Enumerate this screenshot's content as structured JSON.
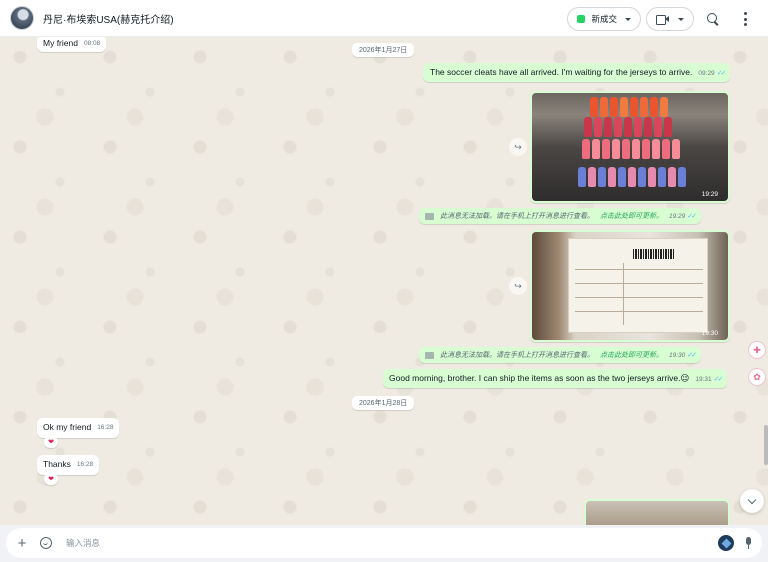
{
  "header": {
    "title": "丹尼·布埃索USA(赫克托介绍)",
    "status_pill_label": "新成交"
  },
  "messages": [
    {
      "direction": "in",
      "text": "My friend",
      "time": "08:08"
    },
    {
      "type": "date",
      "text": "2026年1月27日"
    },
    {
      "direction": "out",
      "text": "The soccer cleats have all arrived. I'm waiting for the jerseys to arrive.",
      "time": "09:29",
      "read": true
    },
    {
      "direction": "out",
      "type": "image",
      "description": "soccer cleats",
      "time": "19:29"
    },
    {
      "direction": "out",
      "type": "system",
      "text": "此消息无法加载。请在手机上打开消息进行查看。",
      "link": "点击此处即可更新。",
      "time": "19:29"
    },
    {
      "direction": "out",
      "type": "image",
      "description": "shipping label",
      "time": "19:30"
    },
    {
      "direction": "out",
      "type": "system",
      "text": "此消息无法加载。请在手机上打开消息进行查看。",
      "link": "点击此处即可更新。",
      "time": "19:30"
    },
    {
      "direction": "out",
      "text": "Good morning, brother. I can ship the items as soon as the two jerseys arrive.",
      "emoji": "😉",
      "time": "19:31",
      "read": true
    },
    {
      "type": "date",
      "text": "2026年1月28日"
    },
    {
      "direction": "in",
      "text": "Ok my friend",
      "time": "16:28",
      "reaction": "❤"
    },
    {
      "direction": "in",
      "text": "Thanks",
      "time": "16:28",
      "reaction": "❤"
    }
  ],
  "composer": {
    "placeholder": "输入消息"
  },
  "colors": {
    "outgoing_bubble": "#d9fdd3",
    "incoming_bubble": "#ffffff",
    "chat_background": "#efeae2",
    "read_ticks": "#53bdeb",
    "accent_green": "#25d366"
  },
  "icons": [
    "avatar",
    "video-call-icon",
    "search-icon",
    "menu-dots-icon",
    "forward-icon",
    "plus-icon",
    "emoji-icon",
    "meta-ai-icon",
    "mic-icon",
    "chevron-down-icon"
  ]
}
